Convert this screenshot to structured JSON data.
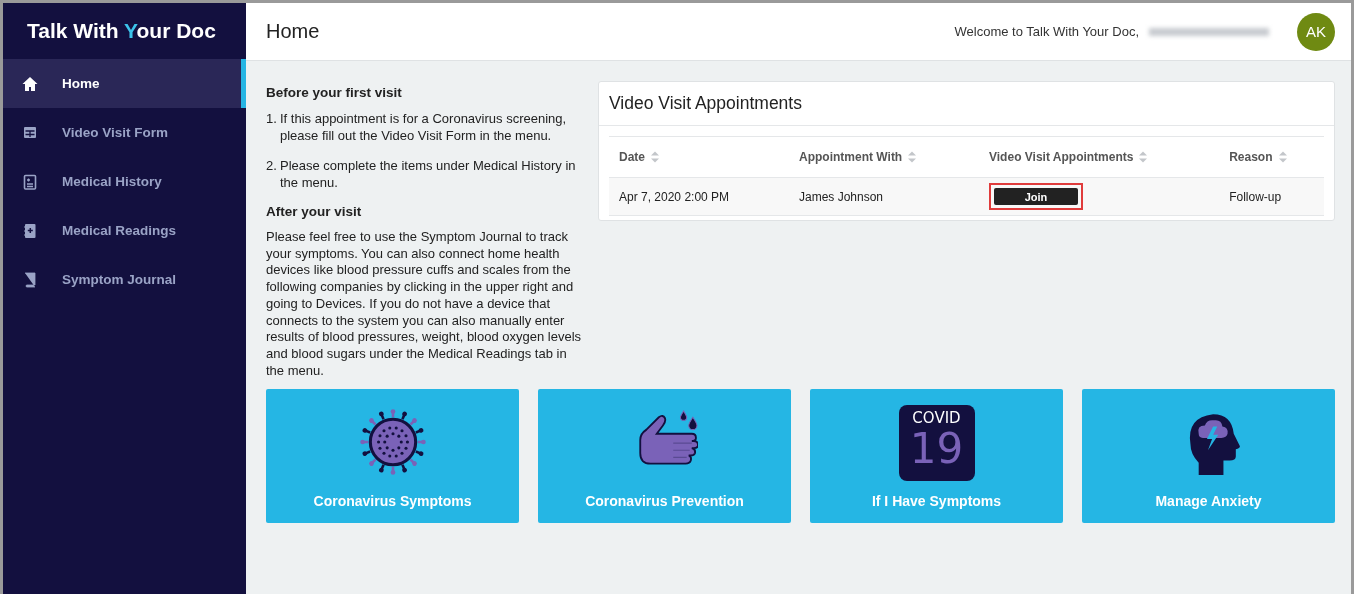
{
  "logo": {
    "before": "Talk With ",
    "accent": "Y",
    "after": "our Doc"
  },
  "sidebar": {
    "items": [
      {
        "label": "Home",
        "selected": true
      },
      {
        "label": "Video Visit Form",
        "selected": false
      },
      {
        "label": "Medical History",
        "selected": false
      },
      {
        "label": "Medical Readings",
        "selected": false
      },
      {
        "label": "Symptom Journal",
        "selected": false
      }
    ]
  },
  "header": {
    "title": "Home",
    "welcome": "Welcome to Talk With Your Doc,",
    "avatar": "AK"
  },
  "intro": {
    "sections": [
      {
        "heading": "Before your first visit",
        "kind": "numbered",
        "items": [
          {
            "number": "1.",
            "text": "If this appointment is for a Coronavirus screening, please fill out the Video Visit Form in the menu."
          },
          {
            "number": "2.",
            "text": "Please complete the items under Medical History in the menu."
          }
        ]
      },
      {
        "heading": "After your visit",
        "kind": "paragraph",
        "items": [
          "Please feel free to use the Symptom Journal to track your symptoms. You can also connect home health devices like blood pressure cuffs and scales from the following companies by clicking in the upper right and going to Devices. If you do not have a device that connects to the system you can also manually enter results of blood pressures, weight, blood oxygen levels and blood sugars under the Medical Readings tab in the menu."
        ]
      }
    ]
  },
  "appointments": {
    "title": "Video Visit Appointments",
    "columns": [
      "Date",
      "Appointment With",
      "Video Visit Appointments",
      "Reason"
    ],
    "rows": [
      {
        "date": "Apr 7, 2020 2:00 PM",
        "with": "James Johnson",
        "action": "Join",
        "highlighted": true,
        "reason": "Follow-up"
      }
    ]
  },
  "tiles": [
    {
      "label": "Coronavirus Symptoms"
    },
    {
      "label": "Coronavirus Prevention"
    },
    {
      "label": "If I Have Symptoms",
      "icon_text": [
        "COVID",
        "19"
      ]
    },
    {
      "label": "Manage Anxiety"
    }
  ]
}
